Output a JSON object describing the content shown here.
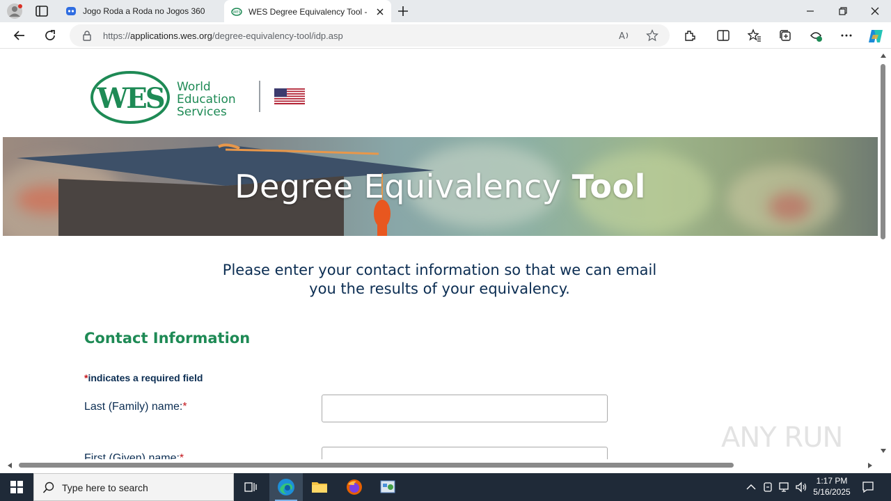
{
  "browser": {
    "tabs": [
      {
        "title": "Jogo Roda a Roda no Jogos 360",
        "active": false
      },
      {
        "title": "WES Degree Equivalency Tool - W",
        "active": true
      }
    ],
    "url_prefix": "https://",
    "url_host": "applications.wes.org",
    "url_path": "/degree-equivalency-tool/idp.asp"
  },
  "page": {
    "logo_text_line1": "World",
    "logo_text_line2": "Education",
    "logo_text_line3": "Services",
    "logo_mark": "WES",
    "hero_title_regular": "Degree Equivalency ",
    "hero_title_bold": "Tool",
    "intro_line1": "Please enter your contact information so that we can email",
    "intro_line2": "you the results of your equivalency.",
    "section_title": "Contact Information",
    "required_note_star": "*",
    "required_note_text": "indicates a required field",
    "fields": [
      {
        "label": "Last (Family) name:",
        "required": "*",
        "value": ""
      },
      {
        "label": "First (Given) name:",
        "required": "*",
        "value": ""
      }
    ]
  },
  "watermark": "ANY RUN",
  "taskbar": {
    "search_placeholder": "Type here to search",
    "time": "1:17 PM",
    "date": "5/16/2025"
  },
  "colors": {
    "wes_green": "#1e8a55",
    "navy": "#0b2d52",
    "required_red": "#c4161c"
  }
}
